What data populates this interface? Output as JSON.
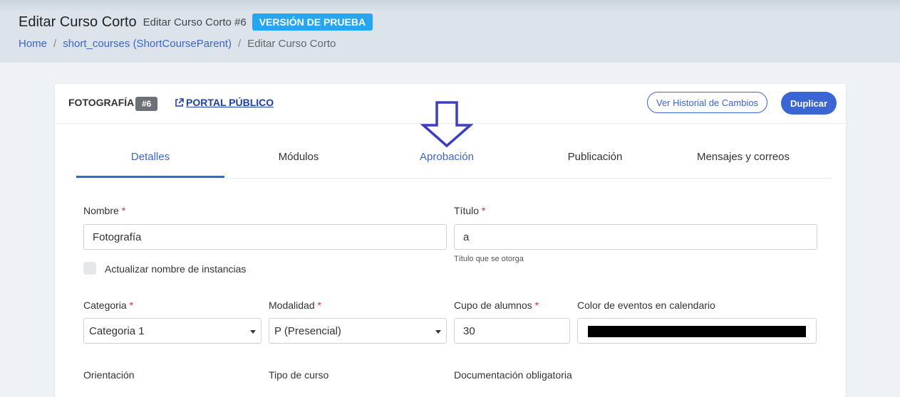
{
  "header": {
    "title": "Editar Curso Corto",
    "subtitle": "Editar Curso Corto #6",
    "badge": "VERSIÓN DE PRUEBA",
    "breadcrumb": [
      "Home",
      "short_courses (ShortCourseParent)",
      "Editar Curso Corto"
    ]
  },
  "card": {
    "course_name": "FOTOGRAFÍA",
    "id_badge": "#6",
    "portal_link": "PORTAL PÚBLICO",
    "history_button": "Ver Historial de Cambios",
    "duplicate_button": "Duplicar"
  },
  "tabs": [
    {
      "label": "Detalles"
    },
    {
      "label": "Módulos"
    },
    {
      "label": "Aprobación"
    },
    {
      "label": "Publicación"
    },
    {
      "label": "Mensajes y correos"
    }
  ],
  "form": {
    "required_mark": "*",
    "nombre": {
      "label": "Nombre",
      "value": "Fotografía"
    },
    "titulo": {
      "label": "Título",
      "value": "a",
      "hint": "Título que se otorga"
    },
    "actualizar": {
      "label": "Actualizar nombre de instancias"
    },
    "categoria": {
      "label": "Categoria",
      "value": "Categoria 1"
    },
    "modalidad": {
      "label": "Modalidad",
      "value": "P (Presencial)"
    },
    "cupo": {
      "label": "Cupo de alumnos",
      "value": "30"
    },
    "color": {
      "label": "Color de eventos en calendario",
      "value": "#000000"
    },
    "orientacion": {
      "label": "Orientación"
    },
    "tipo": {
      "label": "Tipo de curso"
    },
    "documentacion": {
      "label": "Documentación obligatoria"
    }
  },
  "colors": {
    "accent": "#3a66c9",
    "badge": "#26a6f0",
    "arrow": "#3d3fc0"
  },
  "icons": {
    "portal": "external-link-icon",
    "select_caret": "chevron-down-icon",
    "annotation": "arrow-down-icon"
  }
}
